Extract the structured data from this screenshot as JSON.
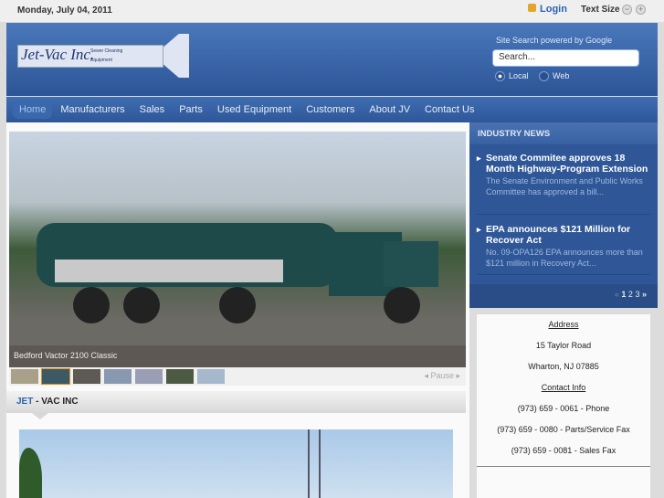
{
  "topbar": {
    "date": "Monday, July 04, 2011",
    "login": "Login",
    "text_size": "Text Size",
    "minus": "−",
    "plus": "+"
  },
  "logo": {
    "name": "Jet-Vac Inc.",
    "tagline1": "Sewer Cleaning",
    "tagline2": "Equipment"
  },
  "search": {
    "label": "Site Search powered by Google",
    "placeholder": "Search...",
    "local": "Local",
    "web": "Web"
  },
  "nav": [
    "Home",
    "Manufacturers",
    "Sales",
    "Parts",
    "Used Equipment",
    "Customers",
    "About JV",
    "Contact Us"
  ],
  "slideshow": {
    "caption": "Bedford Vactor 2100 Classic",
    "pause": "◂ Pause ▸"
  },
  "section": {
    "highlight": "JET",
    "rest": " - VAC INC"
  },
  "news": {
    "heading": "INDUSTRY NEWS",
    "items": [
      {
        "title": "Senate Commitee approves 18 Month Highway-Program Extension",
        "desc": "The Senate Environment and Public Works Committee has approved a bill..."
      },
      {
        "title": "EPA announces $121 Million for Recover Act",
        "desc": "No. 09-OPA126 EPA announces more than $121 million in Recovery Act..."
      }
    ],
    "pager": {
      "prev": "«",
      "p1": "1",
      "p2": "2",
      "p3": "3",
      "next": "»"
    }
  },
  "address": {
    "heading": "Address",
    "street": "15 Taylor Road",
    "city": "Wharton, NJ 07885",
    "contact_heading": "Contact Info",
    "phone": "(973) 659 - 0061 - Phone",
    "fax_parts": "(973) 659 - 0080 - Parts/Service Fax",
    "fax_sales": "(973) 659 - 0081 - Sales Fax"
  }
}
